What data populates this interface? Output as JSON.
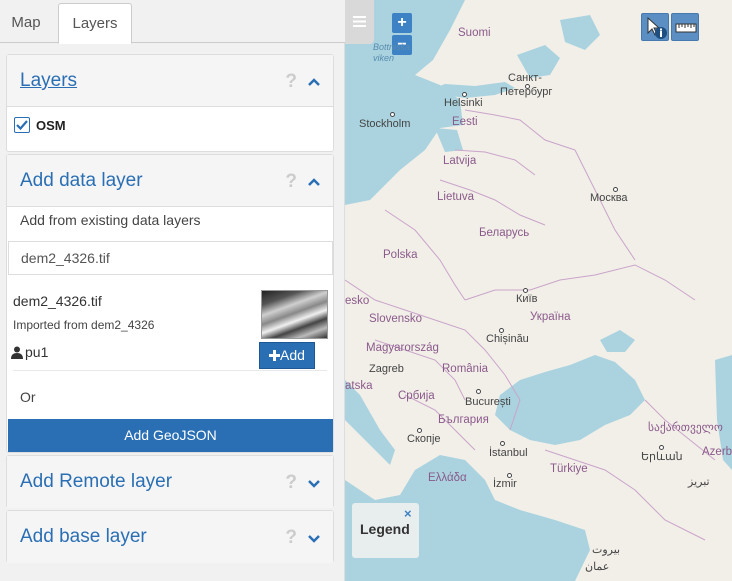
{
  "tabs": [
    {
      "label": "Map",
      "active": false
    },
    {
      "label": "Layers",
      "active": true
    }
  ],
  "layers_section": {
    "title": "Layers",
    "help": "?",
    "items": [
      {
        "label": "OSM",
        "checked": true
      }
    ]
  },
  "add_data_section": {
    "title": "Add data layer",
    "help": "?",
    "existing_label": "Add from existing data layers",
    "search_value": "dem2_4326.tif",
    "result": {
      "name": "dem2_4326.tif",
      "description": "Imported from dem2_4326",
      "user": "pu1",
      "add_label": "Add"
    },
    "or_label": "Or",
    "geojson_label": "Add GeoJSON"
  },
  "remote_section": {
    "title": "Add Remote layer",
    "help": "?"
  },
  "base_section": {
    "title": "Add base layer",
    "help": "?"
  },
  "map": {
    "zoom_in": "+",
    "zoom_out": "−",
    "legend_title": "Legend",
    "legend_close": "×",
    "places": [
      {
        "label": "Suomi",
        "kind": "country"
      },
      {
        "label": "Санкт-",
        "kind": "city"
      },
      {
        "label": "Петербург",
        "kind": "city"
      },
      {
        "label": "Helsinki",
        "kind": "city"
      },
      {
        "label": "Stockholm",
        "kind": "city"
      },
      {
        "label": "Eesti",
        "kind": "country"
      },
      {
        "label": "Latvija",
        "kind": "country"
      },
      {
        "label": "Lietuva",
        "kind": "country"
      },
      {
        "label": "Москва",
        "kind": "city"
      },
      {
        "label": "Беларусь",
        "kind": "country"
      },
      {
        "label": "Polska",
        "kind": "country"
      },
      {
        "label": "Київ",
        "kind": "city"
      },
      {
        "label": "Україна",
        "kind": "country"
      },
      {
        "label": "Slovensko",
        "kind": "country"
      },
      {
        "label": "Chișinău",
        "kind": "city"
      },
      {
        "label": "Magyarország",
        "kind": "country"
      },
      {
        "label": "Zagreb",
        "kind": "city"
      },
      {
        "label": "România",
        "kind": "country"
      },
      {
        "label": "Србија",
        "kind": "country"
      },
      {
        "label": "București",
        "kind": "city"
      },
      {
        "label": "България",
        "kind": "country"
      },
      {
        "label": "Скопје",
        "kind": "city"
      },
      {
        "label": "საქართველო",
        "kind": "country"
      },
      {
        "label": "İstanbul",
        "kind": "city"
      },
      {
        "label": "Türkiye",
        "kind": "country"
      },
      {
        "label": "Երևան",
        "kind": "city"
      },
      {
        "label": "Azerb",
        "kind": "country"
      },
      {
        "label": "Ελλάδα",
        "kind": "country"
      },
      {
        "label": "İzmir",
        "kind": "city"
      },
      {
        "label": "تبریز",
        "kind": "city"
      },
      {
        "label": "بیروت",
        "kind": "city"
      },
      {
        "label": "عمان",
        "kind": "city"
      },
      {
        "label": "Bottniska viken",
        "kind": "water"
      },
      {
        "label": "esko",
        "kind": "country"
      },
      {
        "label": "atska",
        "kind": "country"
      }
    ]
  },
  "colors": {
    "accent": "#2a6fb4",
    "water": "#aad3df",
    "land": "#f2efe9",
    "border": "#c9a4c9"
  }
}
